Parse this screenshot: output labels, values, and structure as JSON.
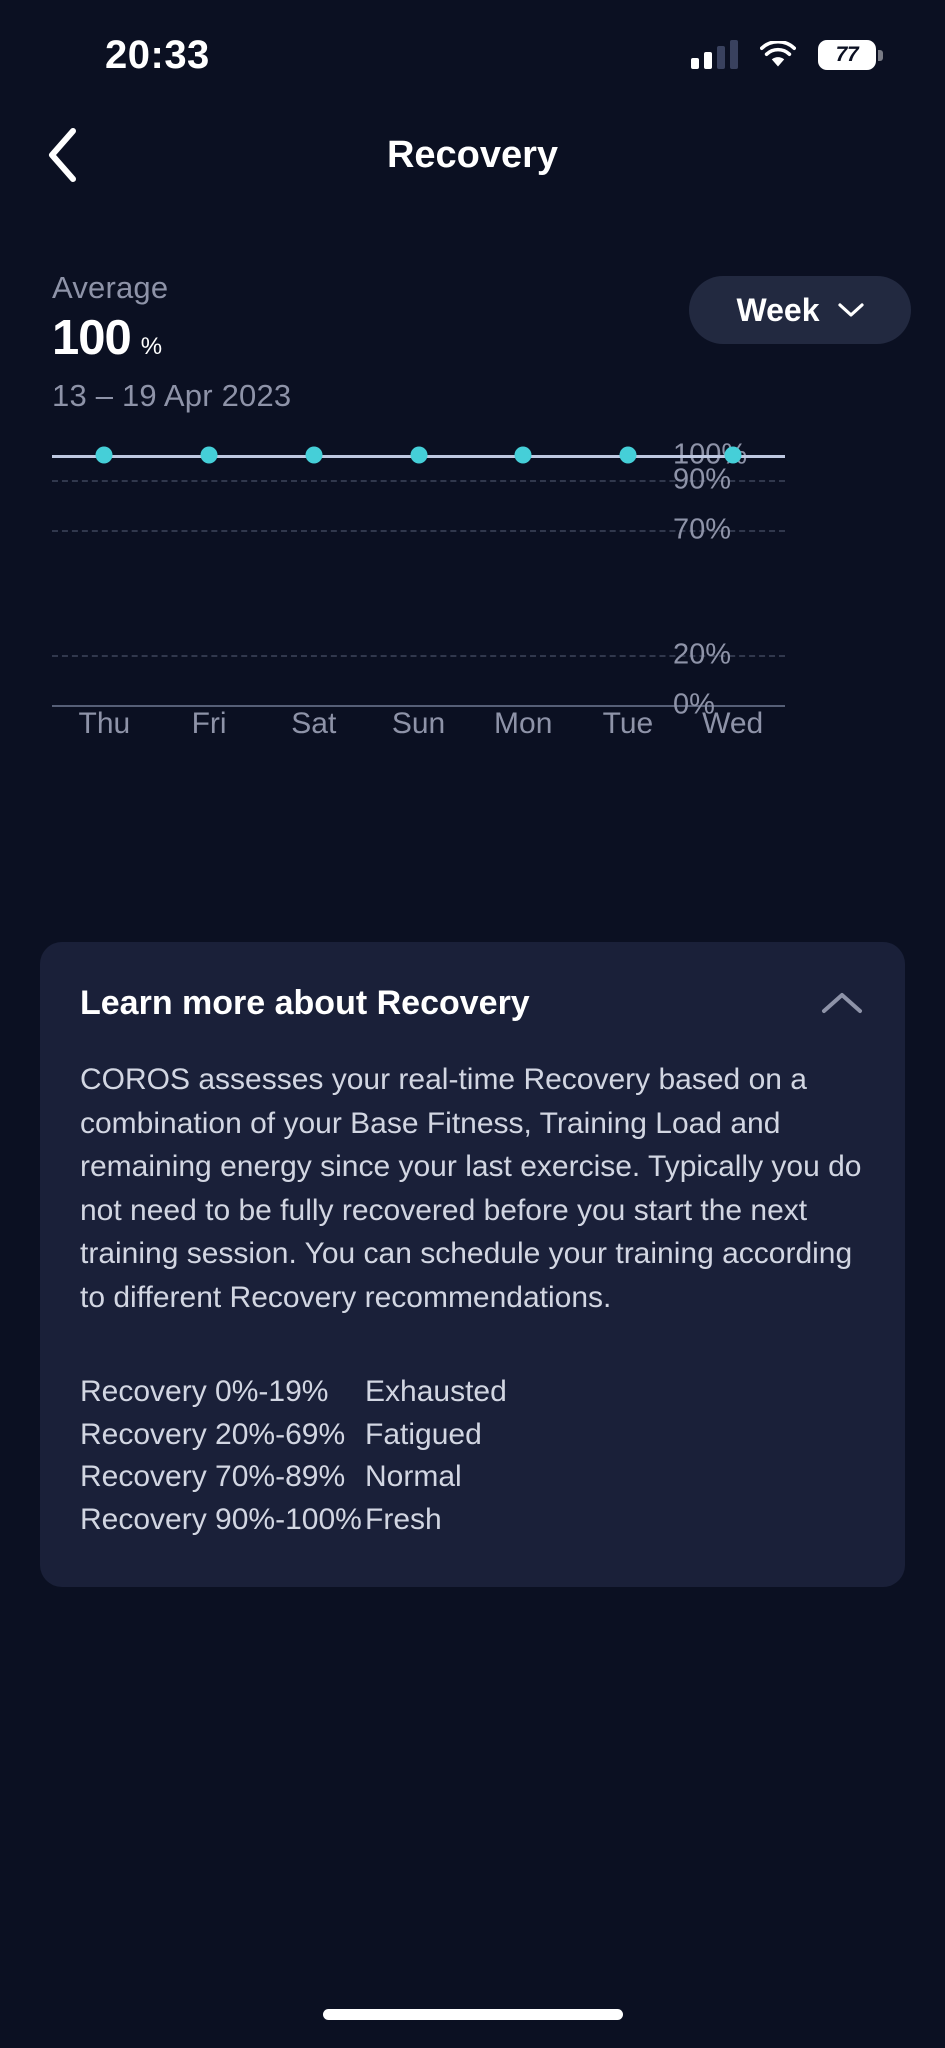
{
  "status_bar": {
    "time": "20:33",
    "battery_percent": "77",
    "signal_icon": "cellular-signal-icon",
    "wifi_icon": "wifi-icon",
    "battery_icon": "battery-icon"
  },
  "nav": {
    "title": "Recovery",
    "back_icon": "chevron-left-icon"
  },
  "summary": {
    "average_label": "Average",
    "average_value": "100",
    "average_unit": "%",
    "date_range": "13 – 19 Apr 2023",
    "period_button": "Week",
    "period_chevron_icon": "chevron-down-icon"
  },
  "chart_data": {
    "type": "line",
    "title": "Recovery",
    "categories": [
      "Thu",
      "Fri",
      "Sat",
      "Sun",
      "Mon",
      "Tue",
      "Wed"
    ],
    "values": [
      100,
      100,
      100,
      100,
      100,
      100,
      100
    ],
    "ylabel": "",
    "xlabel": "",
    "ylim": [
      0,
      100
    ],
    "ytick_values": [
      100,
      90,
      70,
      20,
      0
    ],
    "ytick_labels": [
      "100%",
      "90%",
      "70%",
      "20%",
      "0%"
    ],
    "grid": true,
    "legend": "none",
    "series_color": "#45cfd8",
    "line_color": "#bec8e1"
  },
  "info_card": {
    "title": "Learn more about Recovery",
    "collapse_icon": "chevron-up-icon",
    "body": "COROS assesses your real-time Recovery based on a combination of your Base Fitness, Training Load and remaining energy since your last exercise. Typically you do not need to be fully recovered before you start the next training session. You can schedule your training according to different Recovery recommendations.",
    "ranges": [
      {
        "range": "Recovery 0%-19%",
        "label": "Exhausted"
      },
      {
        "range": "Recovery 20%-69%",
        "label": "Fatigued"
      },
      {
        "range": "Recovery 70%-89%",
        "label": "Normal"
      },
      {
        "range": "Recovery 90%-100%",
        "label": "Fresh"
      }
    ]
  },
  "colors": {
    "background": "#0b1022",
    "card": "#1a2039",
    "accent": "#45cfd8",
    "muted_text": "#8e93a8",
    "body_text": "#d2d6e2"
  }
}
